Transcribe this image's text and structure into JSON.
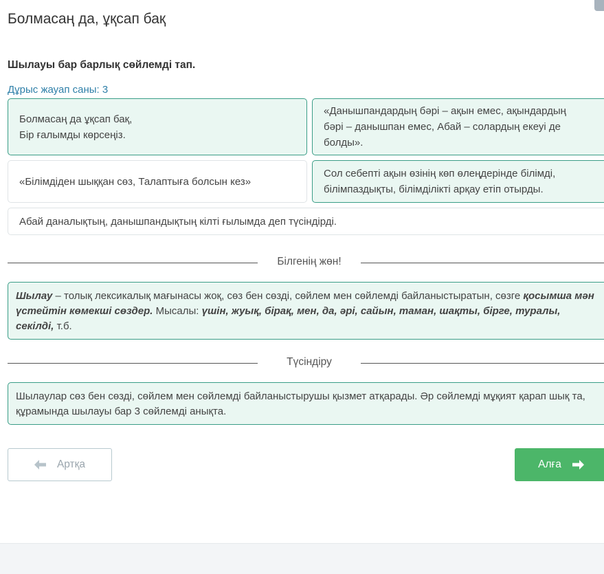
{
  "page": {
    "title": "Болмасаң да, ұқсап бақ"
  },
  "question": {
    "prompt": "Шылауы бар барлық сөйлемді тап.",
    "answer_count": "Дұрыс жауап саны: 3"
  },
  "options": [
    {
      "lines": [
        "Болмасаң да ұқсап бақ,",
        "Бір ғалымды көрсеңіз."
      ],
      "selected": true
    },
    {
      "lines": [
        "«Данышпандардың бәрі – ақын емес, ақындардың",
        "бәрі – данышпан емес, Абай – солардың екеуі де",
        "болды»."
      ],
      "selected": true
    },
    {
      "lines": [
        "«Білімдіден шыққан сөз, Талаптыға болсын кез»"
      ],
      "selected": false
    },
    {
      "lines": [
        "Сол себепті ақын өзінің көп өлеңдерінде білімді,",
        "білімпаздықты, білімділікті арқау етіп отырды."
      ],
      "selected": true
    },
    {
      "lines": [
        "Абай даналықтың, данышпандықтың кілті ғылымда деп түсіндірді."
      ],
      "selected": false
    }
  ],
  "know_section": {
    "heading": "Білгенің жөн!",
    "term": "Шылау",
    "text1": " – толық лексикалық мағынасы жоқ, сөз бен сөзді, сөйлем мен сөйлемді байланыстыратын, сөзге ",
    "emph1": "қосымша мән үстейтін көмекші сөздер.",
    "text2": " Мысалы: ",
    "examples": "үшін, жуық, бірақ, мен, да, әрі, сайын, таман, шақты, бірге, туралы, секілді,",
    "text3": " т.б."
  },
  "explain_section": {
    "heading": "Түсіндіру",
    "text": "Шылаулар сөз бен сөзді, сөйлем мен сөйлемді байланыстырушы қызмет атқарады. Әр сөйлемді мұқият қарап шық та, құрамында шылауы бар 3 сөйлемді анықта."
  },
  "nav": {
    "back_label": "Артқа",
    "next_label": "Алға"
  },
  "icons": {
    "back": "arrow-left-icon",
    "next": "arrow-right-icon"
  },
  "colors": {
    "accent": "#3a9d87",
    "selected_bg": "#eaf7f2",
    "next_button": "#4cb669",
    "link": "#2e7fa8"
  }
}
